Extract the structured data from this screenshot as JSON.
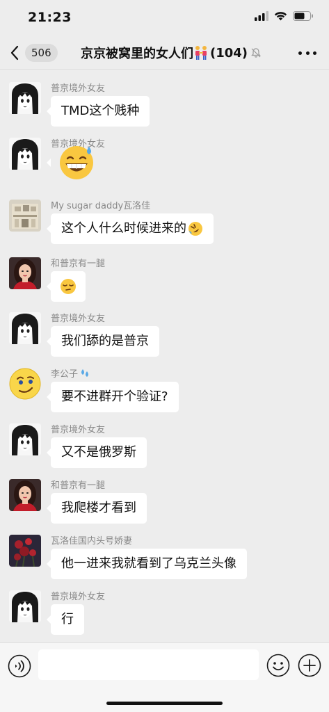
{
  "status": {
    "time": "21:23",
    "icons": [
      "signal-icon",
      "wifi-icon",
      "battery-icon"
    ]
  },
  "nav": {
    "back_count": "506",
    "title": "京京被窝里的女人们",
    "title_emoji": "people-holding-hands-icon",
    "member_count": "(104)",
    "muted_icon": "bell-muted-icon",
    "more_icon": "more-icon"
  },
  "messages": [
    {
      "sender": "普京境外女友",
      "avatar": "manga-girl-avatar",
      "text": "TMD这个贱种"
    },
    {
      "sender": "普京境外女友",
      "avatar": "manga-girl-avatar",
      "emoji": "grinning-sweat-emoji"
    },
    {
      "sender": "My sugar daddy瓦洛佳",
      "avatar": "building-photo-avatar",
      "text": "这个人什么时候进来的",
      "trailing_emoji": "rofl-emoji"
    },
    {
      "sender": "和普京有一腿",
      "avatar": "woman-photo-avatar",
      "emoji": "pensive-emoji"
    },
    {
      "sender": "普京境外女友",
      "avatar": "manga-girl-avatar",
      "text": "我们舔的是普京"
    },
    {
      "sender": "李公子",
      "sender_icon": "droplets-icon",
      "avatar": "smirk-face-avatar",
      "text": "要不进群开个验证?"
    },
    {
      "sender": "普京境外女友",
      "avatar": "manga-girl-avatar",
      "text": "又不是俄罗斯"
    },
    {
      "sender": "和普京有一腿",
      "avatar": "woman-photo-avatar",
      "text": "我爬楼才看到"
    },
    {
      "sender": "瓦洛佳国内头号娇妻",
      "avatar": "roses-photo-avatar",
      "text": "他一进来我就看到了乌克兰头像"
    },
    {
      "sender": "普京境外女友",
      "avatar": "manga-girl-avatar",
      "text": "行"
    }
  ],
  "input_bar": {
    "voice_icon": "voice-icon",
    "text_value": "",
    "emoji_icon": "emoji-icon",
    "plus_icon": "plus-icon"
  },
  "colors": {
    "background": "#ededed",
    "bubble": "#ffffff",
    "sender_name": "#888888"
  }
}
